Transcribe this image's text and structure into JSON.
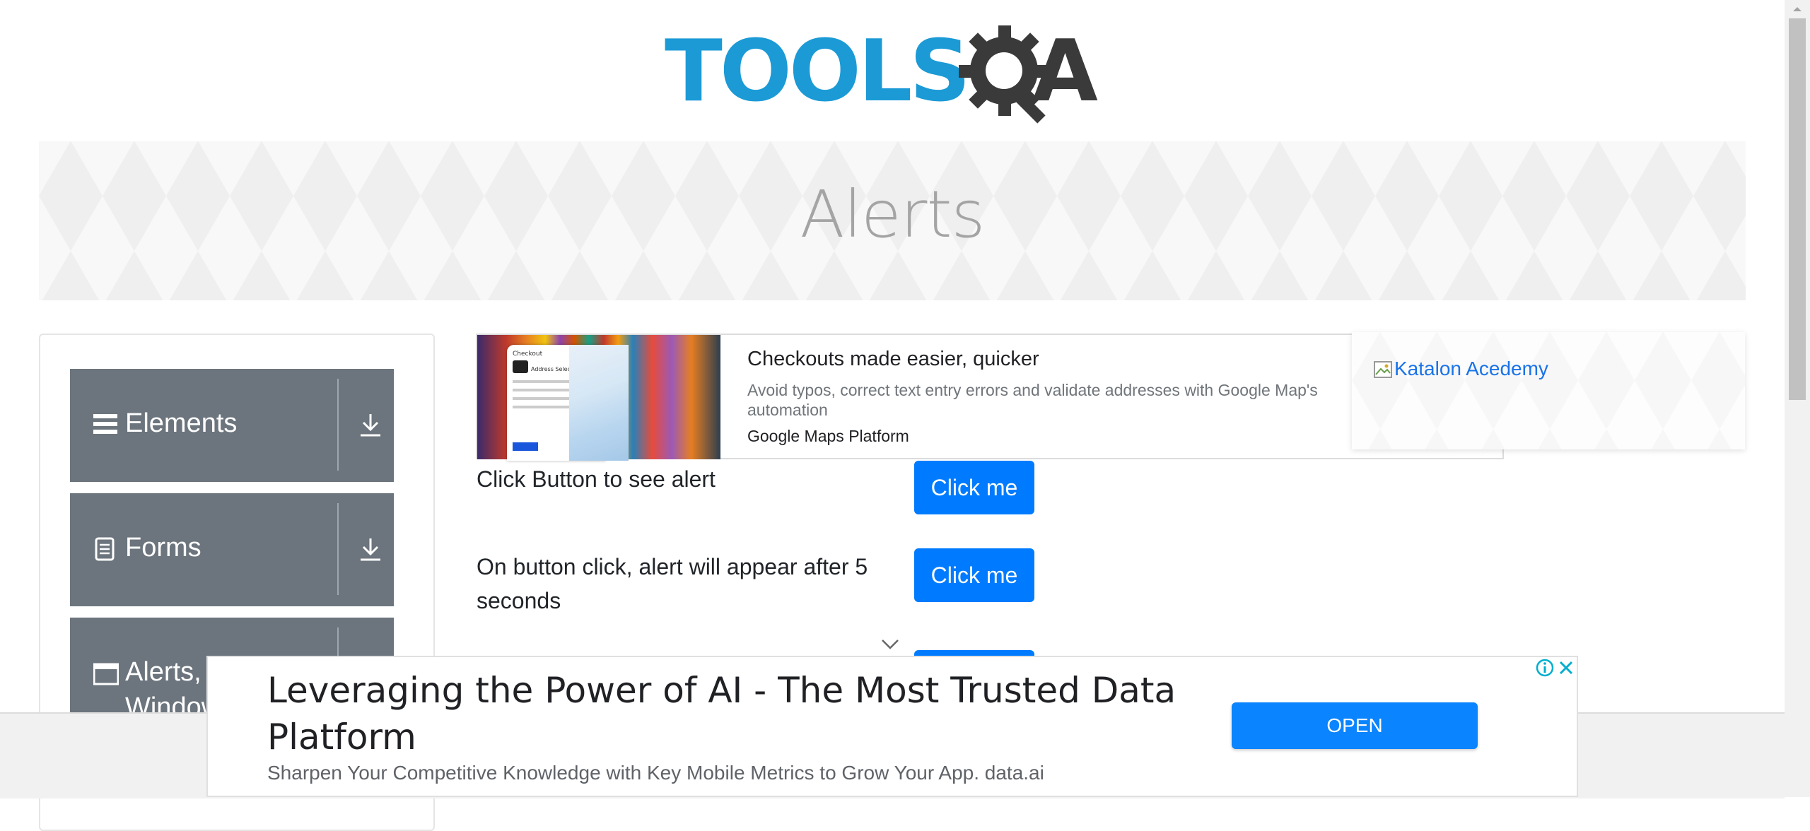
{
  "logo": {
    "text_main": "TOOLS",
    "text_q_a": "A",
    "brand_blue": "#1b9ad6",
    "brand_dark": "#3a3a3a"
  },
  "banner": {
    "title": "Alerts"
  },
  "sidebar": {
    "groups": [
      {
        "label": "Elements",
        "icon": "hamburger-icon"
      },
      {
        "label": "Forms",
        "icon": "document-icon"
      },
      {
        "label": "Alerts, Frame & Windows",
        "icon": "window-icon"
      }
    ]
  },
  "ad_card": {
    "title": "Checkouts made easier, quicker",
    "description": "Avoid typos, correct text entry errors and validate addresses with Google Map's automation",
    "brand": "Google Maps Platform",
    "phone_heading": "Checkout",
    "phone_sub": "Address Selection"
  },
  "katalon": {
    "link_text": "Katalon Acedemy"
  },
  "rows": [
    {
      "label": "Click Button to see alert",
      "button": "Click me"
    },
    {
      "label": "On button click, alert will appear after 5 seconds",
      "button": "Click me"
    }
  ],
  "bottom_ad": {
    "headline": "Leveraging the Power of AI - The Most Trusted Data Platform",
    "subtext": "Sharpen Your Competitive Knowledge with Key Mobile Metrics to Grow Your App. data.ai",
    "open_label": "OPEN",
    "accent": "#0a84ff"
  },
  "colors": {
    "primary_button": "#007bff",
    "sidebar_group": "#6c757d"
  }
}
